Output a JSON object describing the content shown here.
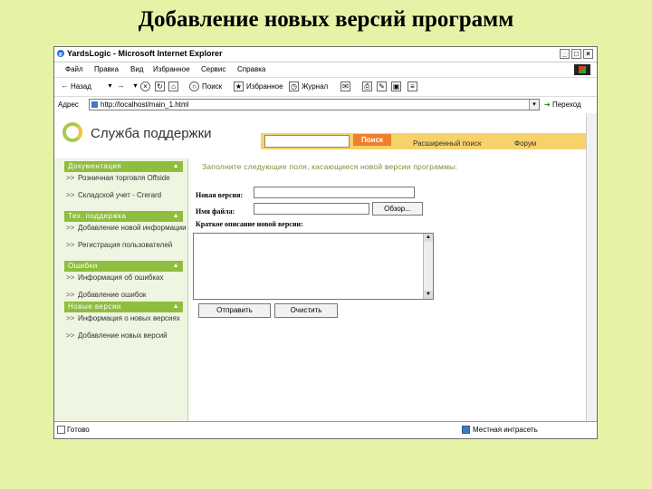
{
  "slide": {
    "title": "Добавление новых версий программ"
  },
  "window": {
    "title": "YardsLogic - Microsoft Internet Explorer",
    "controls": {
      "minimize": "_",
      "maximize": "□",
      "close": "×"
    }
  },
  "menu": [
    "Файл",
    "Правка",
    "Вид",
    "Избранное",
    "Сервис",
    "Справка"
  ],
  "toolbar": {
    "back": "Назад",
    "search": "Поиск",
    "favorites": "Избранное",
    "media": "Журнал"
  },
  "address": {
    "label": "Адрес",
    "url": "http://localhost/main_1.html",
    "go": "Переход"
  },
  "site": {
    "logo_text": "Служба поддержки",
    "search_button": "Поиск",
    "search_value": "",
    "advanced_search": "Расширенный поиск",
    "forum": "Форум"
  },
  "sidebar": {
    "sections": [
      {
        "title": "Документация",
        "items": [
          "Розничная торговля Offside",
          "Складской учет - Crerard"
        ]
      },
      {
        "title": "Тех. поддержка",
        "items": [
          "Добавление новой информации",
          "Регистрация пользователей"
        ]
      },
      {
        "title": "Ошибки",
        "items": [
          "Информация об ошибках",
          "Добавление ошибок"
        ]
      },
      {
        "title": "Новые версии",
        "items": [
          "Информация о новых версиях",
          "Добавление новых версий"
        ]
      }
    ],
    "bullet": ">>",
    "collapse_arrow": "▲"
  },
  "form": {
    "intro": "Заполните следующие поля, касающиеся новой версии программы:",
    "version_label": "Новая версия:",
    "version_value": "",
    "file_label": "Имя файла:",
    "file_value": "",
    "browse_button": "Обзор...",
    "description_label": "Краткое описание новой версии:",
    "description_value": "",
    "submit_button": "Отправить",
    "clear_button": "Очистить"
  },
  "status": {
    "left": "Готово",
    "right": "Местная интрасеть"
  },
  "colors": {
    "slide_bg": "#e6f3a7",
    "accent_green": "#8fbd3e",
    "accent_orange": "#f07f2b",
    "header_yellow": "#f7d16a"
  }
}
